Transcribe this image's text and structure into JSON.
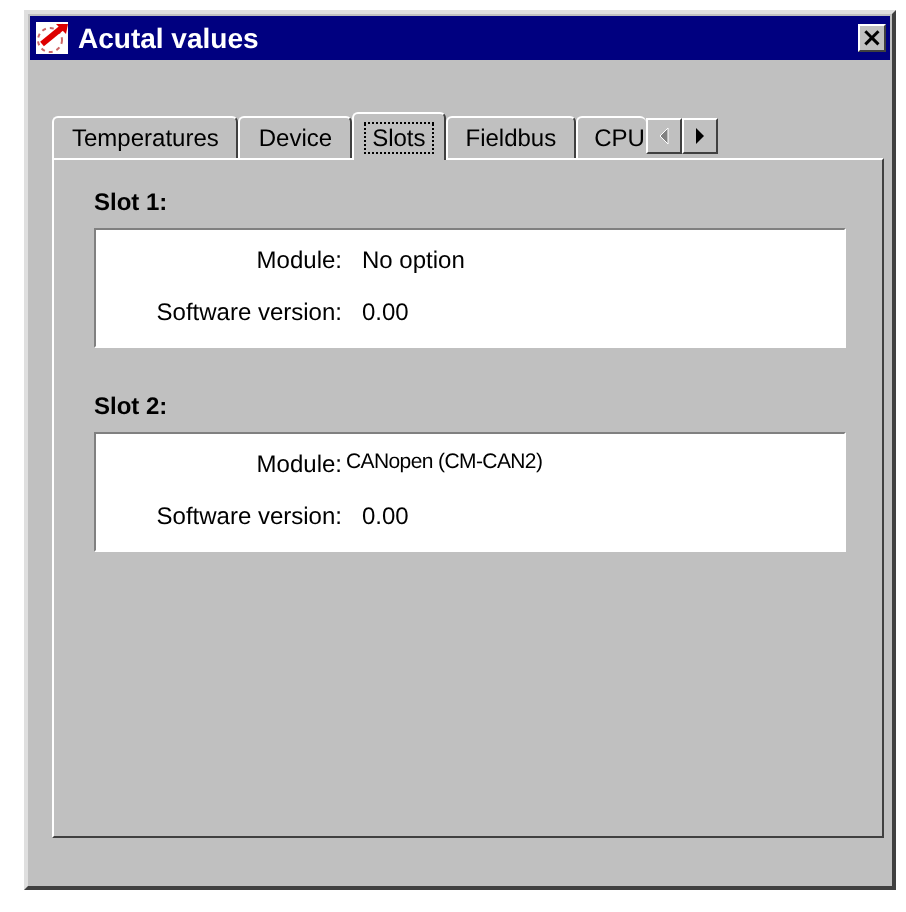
{
  "window": {
    "title": "Acutal values",
    "close": "×"
  },
  "tabs": [
    {
      "label": "Temperatures",
      "selected": false
    },
    {
      "label": "Device",
      "selected": false
    },
    {
      "label": "Slots",
      "selected": true
    },
    {
      "label": "Fieldbus",
      "selected": false
    },
    {
      "label": "CPU",
      "selected": false
    }
  ],
  "tab_scroll": [
    {
      "kind": "left",
      "disabled": true
    },
    {
      "kind": "right",
      "disabled": false
    }
  ],
  "slots": [
    {
      "title": "Slot 1:",
      "rows": [
        {
          "label": "Module:",
          "value": "No option",
          "kind": "normal"
        },
        {
          "label": "Software version:",
          "value": "0.00",
          "kind": "normal"
        }
      ]
    },
    {
      "title": "Slot 2:",
      "rows": [
        {
          "label": "Module:",
          "value": "CANopen (CM-CAN2)",
          "kind": "condensed"
        },
        {
          "label": "Software version:",
          "value": "0.00",
          "kind": "normal"
        }
      ]
    }
  ]
}
